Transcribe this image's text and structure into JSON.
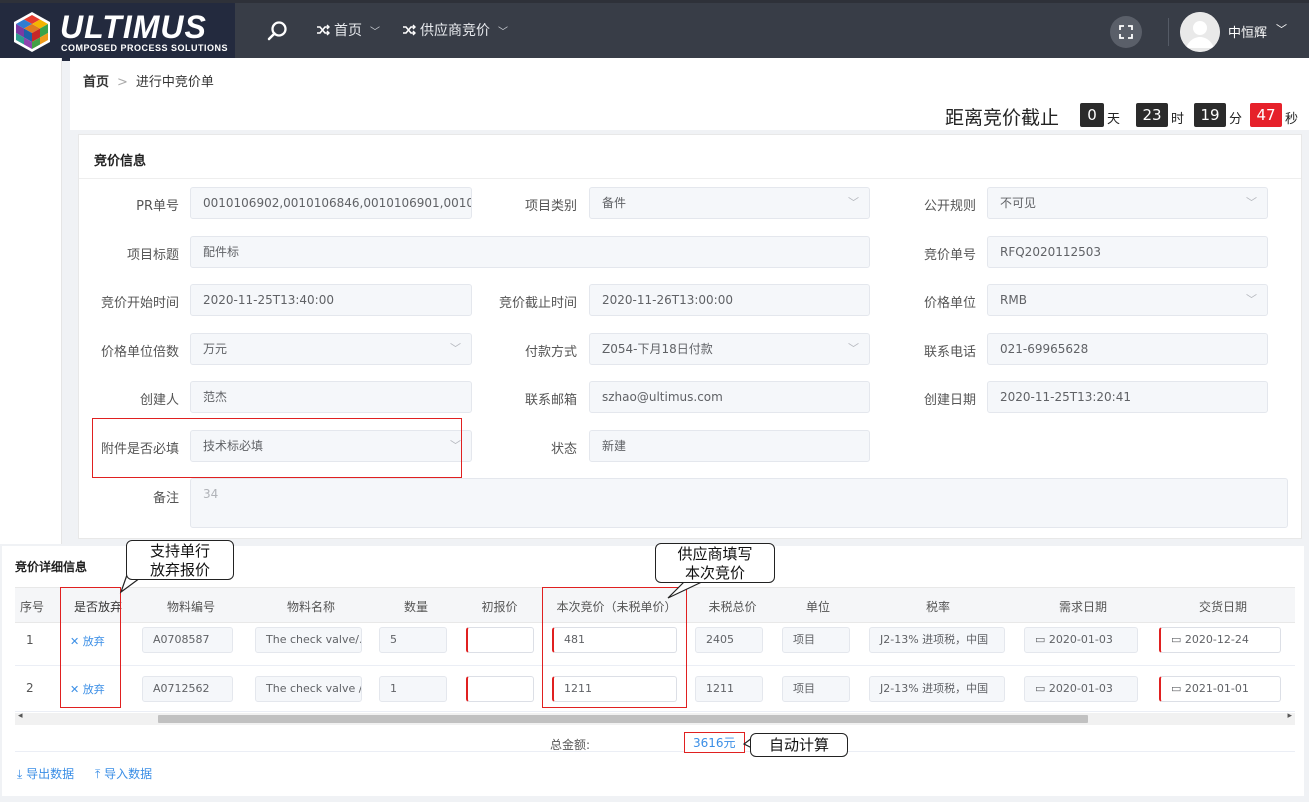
{
  "brand": {
    "name": "ULTIMUS",
    "tagline": "COMPOSED PROCESS SOLUTIONS"
  },
  "topnav": {
    "search_icon": "search-icon",
    "items": [
      {
        "icon": "shuffle-icon",
        "label": "首页"
      },
      {
        "icon": "shuffle-icon",
        "label": "供应商竞价"
      }
    ],
    "fullscreen_icon": "fullscreen-icon",
    "user": "中恒辉"
  },
  "breadcrumb": {
    "home": "首页",
    "current": "进行中竞价单"
  },
  "countdown": {
    "title": "距离竞价截止",
    "days": "0",
    "days_unit": "天",
    "hours": "23",
    "hours_unit": "时",
    "minutes": "19",
    "minutes_unit": "分",
    "seconds": "47",
    "seconds_unit": "秒"
  },
  "info": {
    "title": "竞价信息",
    "pr_no": {
      "label": "PR单号",
      "value": "0010106902,0010106846,0010106901,00101("
    },
    "category": {
      "label": "项目类别",
      "value": "备件"
    },
    "public_rule": {
      "label": "公开规则",
      "value": "不可见"
    },
    "project_title": {
      "label": "项目标题",
      "value": "配件标"
    },
    "rfq_no": {
      "label": "竞价单号",
      "value": "RFQ2020112503"
    },
    "start_time": {
      "label": "竞价开始时间",
      "value": "2020-11-25T13:40:00"
    },
    "end_time": {
      "label": "竞价截止时间",
      "value": "2020-11-26T13:00:00"
    },
    "price_unit": {
      "label": "价格单位",
      "value": "RMB"
    },
    "unit_multiple": {
      "label": "价格单位倍数",
      "value": "万元"
    },
    "payment": {
      "label": "付款方式",
      "value": "Z054-下月18日付款"
    },
    "phone": {
      "label": "联系电话",
      "value": "021-69965628"
    },
    "creator": {
      "label": "创建人",
      "value": "范杰"
    },
    "email": {
      "label": "联系邮箱",
      "value": "szhao@ultimus.com"
    },
    "created_date": {
      "label": "创建日期",
      "value": "2020-11-25T13:20:41"
    },
    "attachment": {
      "label": "附件是否必填",
      "value": "技术标必填"
    },
    "status": {
      "label": "状态",
      "value": "新建"
    },
    "remark": {
      "label": "备注",
      "value": "34"
    }
  },
  "detail": {
    "title": "竞价详细信息",
    "columns": [
      "序号",
      "是否放弃",
      "物料编号",
      "物料名称",
      "数量",
      "初报价",
      "本次竞价（未税单价）",
      "未税总价",
      "单位",
      "税率",
      "需求日期",
      "交货日期"
    ],
    "rows": [
      {
        "no": "1",
        "abandon": "放弃",
        "material_no": "A0708587",
        "material_name": "The check valve/.",
        "qty": "5",
        "init_price": "",
        "bid": "481",
        "total": "2405",
        "unit": "项目",
        "tax": "J2-13% 进项税，中国",
        "need_date": "2020-01-03",
        "delivery": "2020-12-24"
      },
      {
        "no": "2",
        "abandon": "放弃",
        "material_no": "A0712562",
        "material_name": "The check valve /",
        "qty": "1",
        "init_price": "",
        "bid": "1211",
        "total": "1211",
        "unit": "项目",
        "tax": "J2-13% 进项税，中国",
        "need_date": "2020-01-03",
        "delivery": "2021-01-01"
      }
    ],
    "total_label": "总金额:",
    "total_value": "3616元",
    "export": "导出数据",
    "import": "导入数据"
  },
  "callouts": {
    "abandon": "支持单行\n放弃报价",
    "bid": "供应商填写\n本次竞价",
    "auto": "自动计算"
  },
  "colors": {
    "topbar": "#383d47",
    "logo_bg": "#232a3e",
    "highlight": "#e02020",
    "link": "#3a8ee6",
    "countdown_seconds": "#e6212a"
  }
}
